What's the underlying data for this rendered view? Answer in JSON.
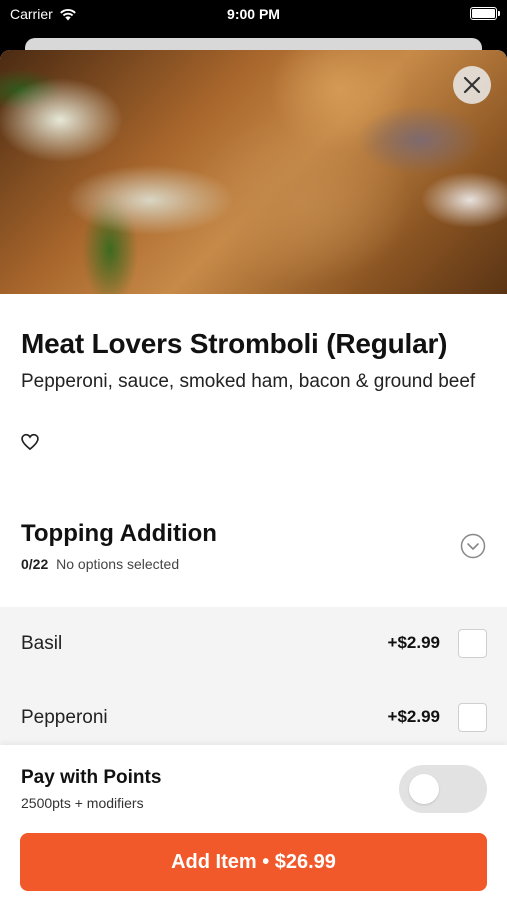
{
  "status_bar": {
    "carrier": "Carrier",
    "time": "9:00 PM"
  },
  "item": {
    "title": "Meat Lovers Stromboli (Regular)",
    "description": "Pepperoni, sauce, smoked ham, bacon & ground beef",
    "favorite_icon": "heart-outline-icon"
  },
  "topping_section": {
    "title": "Topping Addition",
    "selected_count": "0/22",
    "status": "No options selected",
    "options": [
      {
        "name": "Basil",
        "price": "+$2.99",
        "checked": false
      },
      {
        "name": "Pepperoni",
        "price": "+$2.99",
        "checked": false
      }
    ]
  },
  "points": {
    "title": "Pay with Points",
    "subtitle": "2500pts + modifiers",
    "enabled": false
  },
  "add_button": {
    "label": "Add Item • $26.99"
  },
  "colors": {
    "accent": "#f2592a",
    "toggle_off": "#e2e2e2"
  }
}
